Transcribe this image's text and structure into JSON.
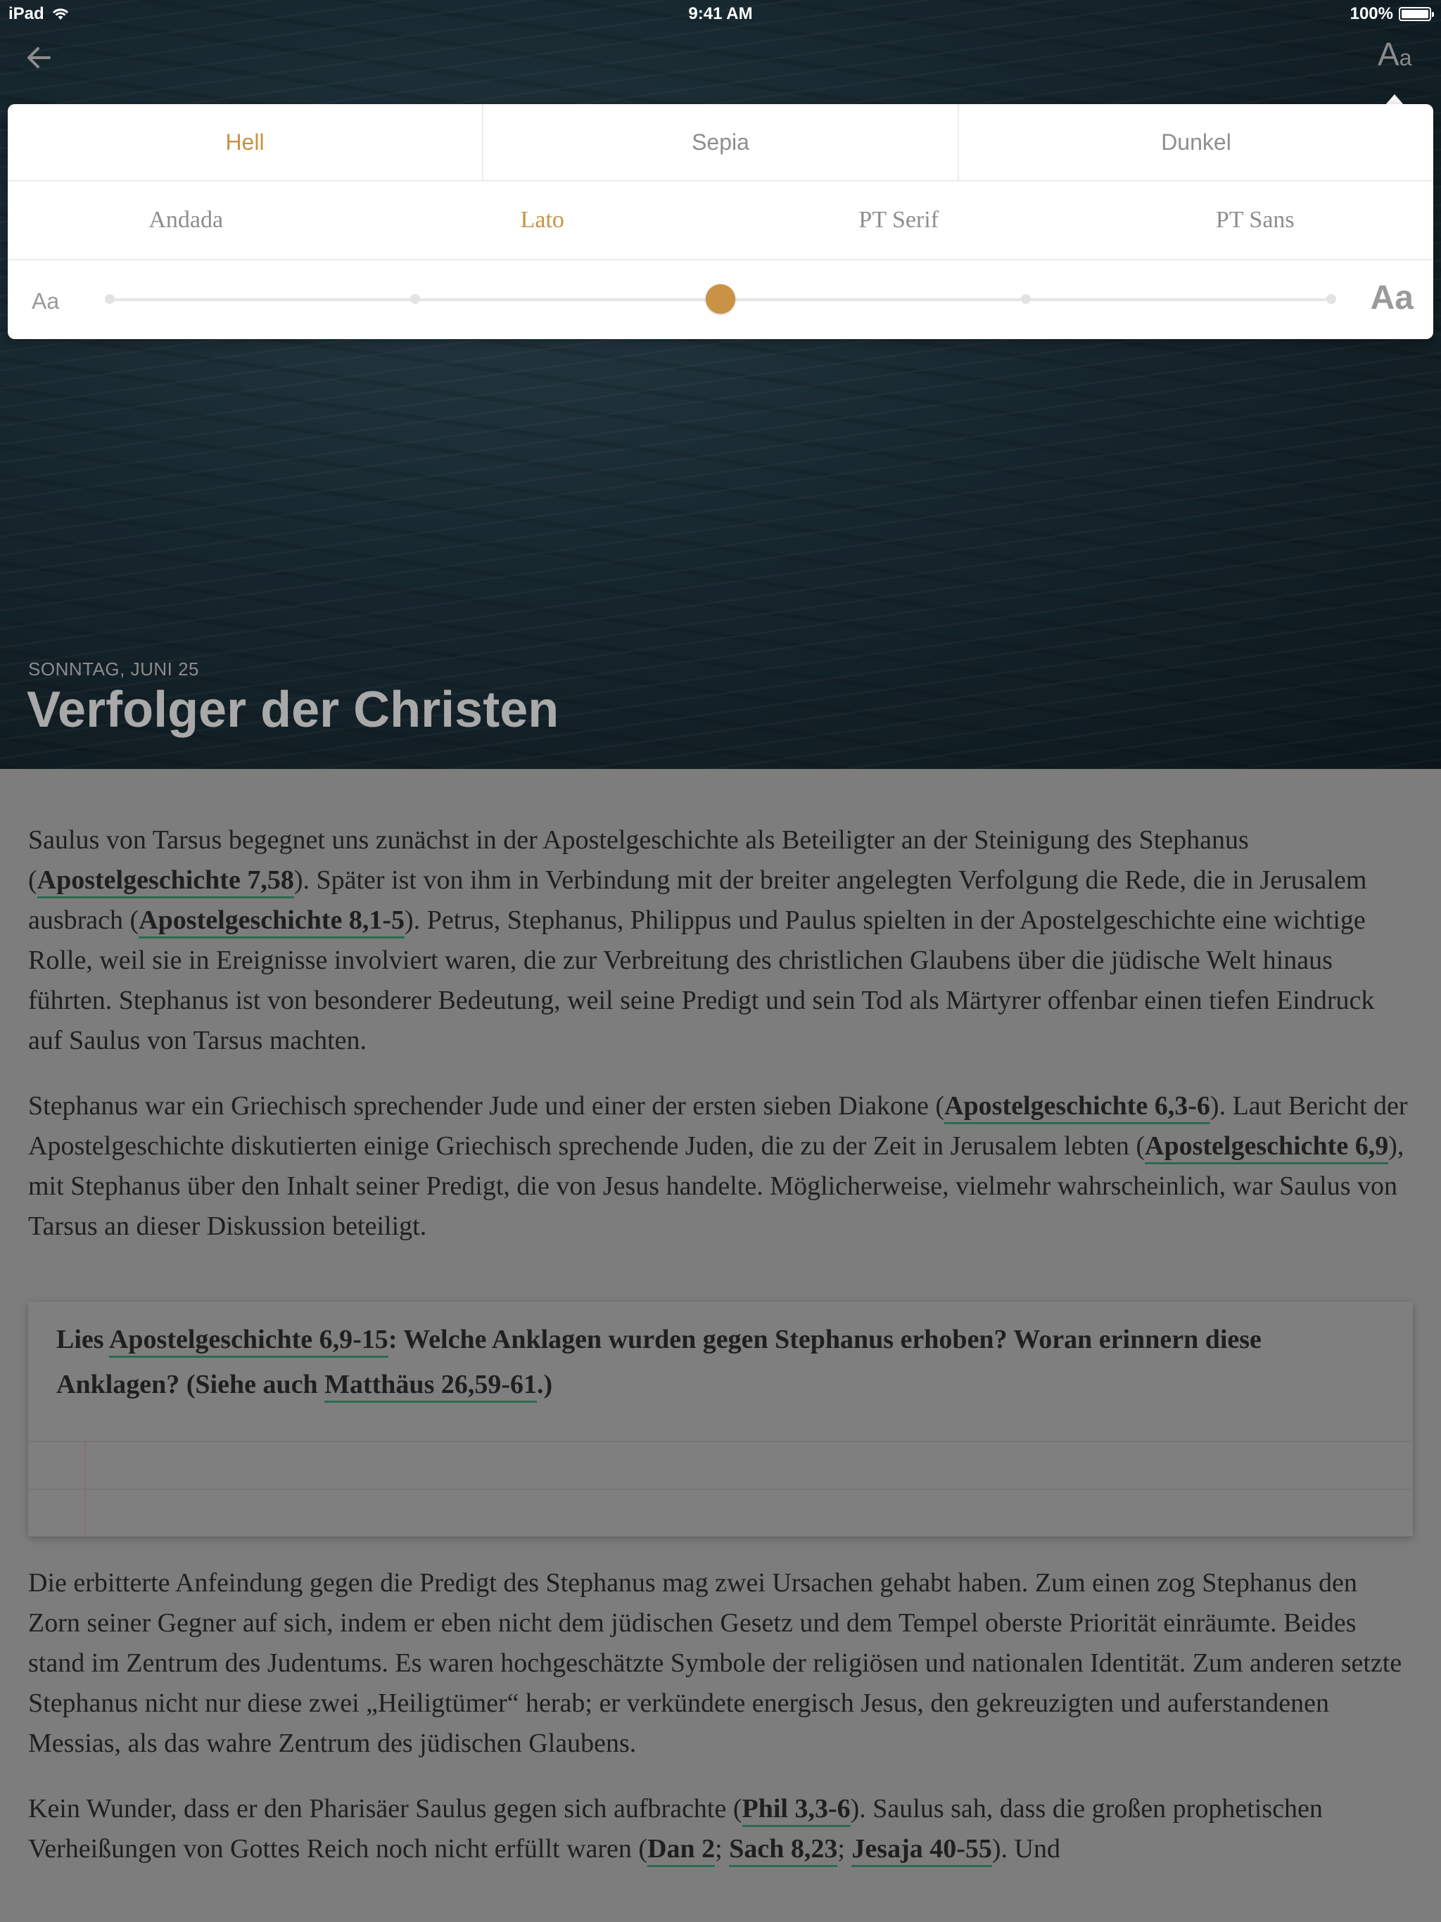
{
  "status_bar": {
    "device": "iPad",
    "time": "9:41 AM",
    "battery_text": "100%",
    "battery_level": 1.0
  },
  "nav": {
    "settings_big": "A",
    "settings_small": "a"
  },
  "settings_popover": {
    "themes": [
      "Hell",
      "Sepia",
      "Dunkel"
    ],
    "selected_theme": "Hell",
    "fonts": [
      "Andada",
      "Lato",
      "PT Serif",
      "PT Sans"
    ],
    "selected_font": "Lato",
    "size_small_label": "Aa",
    "size_large_label": "Aa",
    "size_steps": 5,
    "size_selected_index": 2,
    "accent_color": "#c99244"
  },
  "lesson": {
    "date": "SONNTAG, JUNI 25",
    "title": "Verfolger der Christen"
  },
  "content": {
    "p1": [
      {
        "t": "Saulus von Tarsus begegnet uns zunächst in der Apostelgeschichte als Beteiligter an der Steinigung des Stephanus ("
      },
      {
        "t": "Apostelgeschichte 7,58",
        "ref": true
      },
      {
        "t": "). Später ist von ihm in Verbindung mit der breiter angelegten Verfolgung die Rede, die in Jerusalem ausbrach ("
      },
      {
        "t": "Apostelgeschichte 8,1-5",
        "ref": true
      },
      {
        "t": "). Petrus, Stephanus, Philippus und Paulus spielten in der Apostelgeschichte eine wichtige Rolle, weil sie in Ereignisse involviert waren, die zur Verbreitung des christlichen Glaubens über die jüdische Welt hinaus führten. Stephanus ist von besonderer Bedeutung, weil seine Predigt und sein Tod als Märtyrer offenbar einen tiefen Eindruck auf Saulus von Tarsus machten."
      }
    ],
    "p2": [
      {
        "t": "Stephanus war ein Griechisch sprechender Jude und einer der ersten sieben Diakone ("
      },
      {
        "t": "Apostelgeschichte 6,3-6",
        "ref": true
      },
      {
        "t": "). Laut Bericht der Apostelgeschichte diskutierten einige Griechisch sprechende Juden, die zu der Zeit in Jerusalem lebten ("
      },
      {
        "t": "Apostelgeschichte 6,9",
        "ref": true
      },
      {
        "t": "), mit Stephanus über den Inhalt seiner Predigt, die von Jesus handelte. Möglicherweise, vielmehr wahrscheinlich, war Saulus von Tarsus an dieser Diskussion beteiligt."
      }
    ],
    "question": [
      {
        "t": "Lies "
      },
      {
        "t": "Apostelgeschichte 6,9-15",
        "ref": true
      },
      {
        "t": ": Welche Anklagen wurden gegen Stephanus erhoben? Woran erinnern diese Anklagen? (Siehe auch "
      },
      {
        "t": "Matthäus 26,59-61",
        "ref": true
      },
      {
        "t": ".)"
      }
    ],
    "p3": [
      {
        "t": "Die erbitterte Anfeindung gegen die Predigt des Stephanus mag zwei Ursachen gehabt haben. Zum einen zog Stephanus den Zorn seiner Gegner auf sich, indem er eben nicht dem jüdischen Gesetz und dem Tempel oberste Priorität einräumte. Beides stand im Zentrum des Judentums. Es waren hochgeschätzte Symbole der religiösen und nationalen Identität. Zum anderen setzte Stephanus nicht nur diese zwei „Heiligtümer“ herab; er verkündete energisch Jesus, den gekreuzigten und auferstandenen Messias, als das wahre Zentrum des jüdischen Glaubens."
      }
    ],
    "p4": [
      {
        "t": "Kein Wunder, dass er den Pharisäer Saulus gegen sich aufbrachte ("
      },
      {
        "t": "Phil 3,3-6",
        "ref": true
      },
      {
        "t": "). Saulus sah, dass die großen prophetischen Verheißungen von Gottes Reich noch nicht erfüllt waren ("
      },
      {
        "t": "Dan 2",
        "ref": true
      },
      {
        "t": "; "
      },
      {
        "t": "Sach 8,23",
        "ref": true
      },
      {
        "t": "; "
      },
      {
        "t": "Jesaja 40-55",
        "ref": true
      },
      {
        "t": "). Und"
      }
    ]
  }
}
